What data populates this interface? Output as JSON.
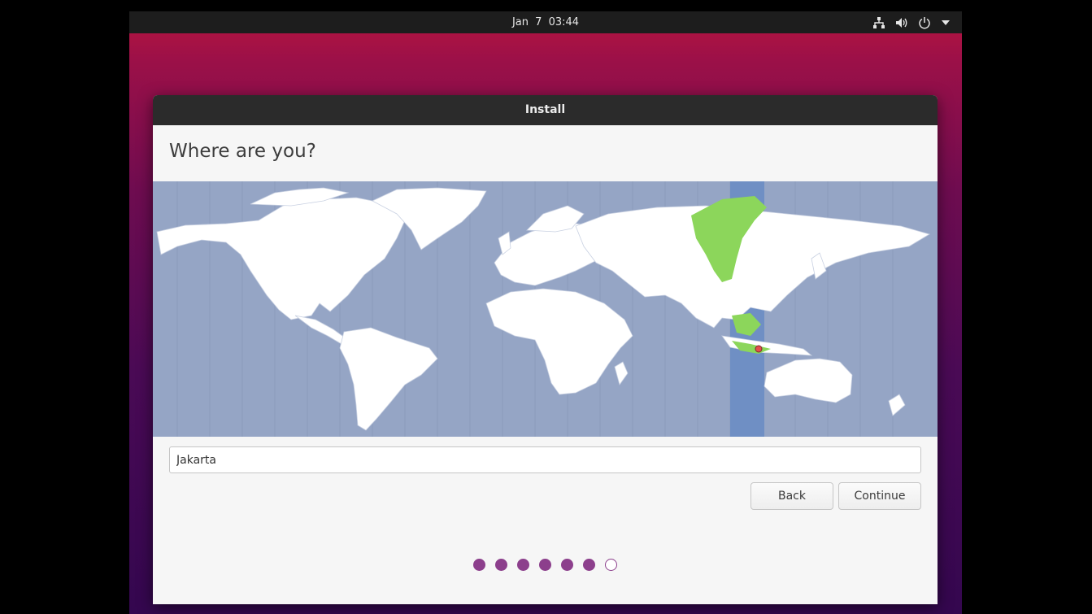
{
  "topbar": {
    "date": "Jan 7",
    "time": "03:44",
    "icons": [
      "network-icon",
      "volume-icon",
      "power-icon",
      "menu-arrow-icon"
    ]
  },
  "window": {
    "title": "Install",
    "heading": "Where are you?"
  },
  "map": {
    "ocean_color": "#95a5c5",
    "land_color": "#ffffff",
    "timezone_highlight_color": "#6f8fc4",
    "selected_region_color": "#8cd65b",
    "marker_color": "#e2504c"
  },
  "location": {
    "value": "Jakarta",
    "placeholder": ""
  },
  "buttons": {
    "back": "Back",
    "continue": "Continue"
  },
  "progress": {
    "total_steps": 7,
    "completed_steps": 6,
    "accent_color": "#8c3f8c"
  }
}
